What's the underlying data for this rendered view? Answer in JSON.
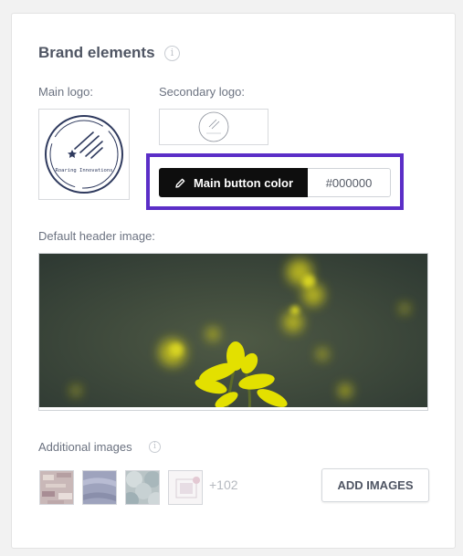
{
  "brand": {
    "title": "Brand elements",
    "title_info_icon": "info-icon",
    "main_logo_label": "Main logo:",
    "main_logo_text": "Roaring Innovations",
    "secondary_logo_label": "Secondary logo:",
    "main_button": {
      "label": "Main button color",
      "icon": "pencil-icon",
      "value": "#000000"
    },
    "header_image_label": "Default header image:",
    "additional": {
      "label": "Additional images",
      "info_icon": "info-icon",
      "more_count": "+102",
      "add_button": "ADD IMAGES"
    }
  },
  "colors": {
    "highlight": "#5b2ec7",
    "button_bg": "#0e0e0e",
    "logo_navy": "#2f3a5e",
    "flower_yellow": "#e3e000"
  }
}
